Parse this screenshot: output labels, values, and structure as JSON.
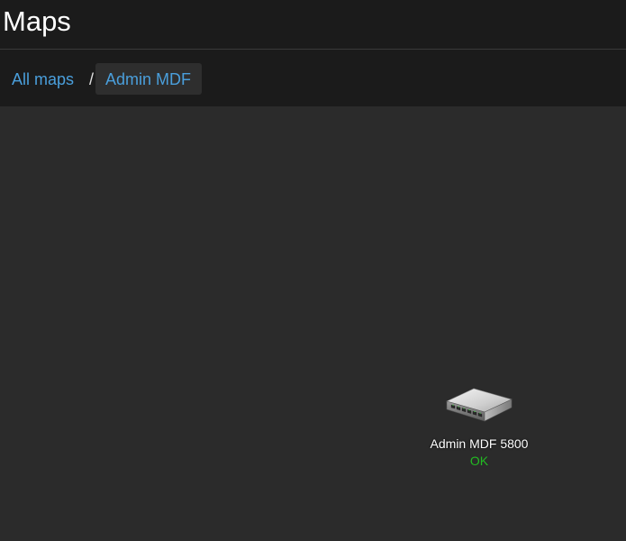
{
  "header": {
    "title": "Maps"
  },
  "breadcrumb": {
    "items": [
      {
        "label": "All maps"
      },
      {
        "label": "Admin MDF"
      }
    ],
    "separator": "/"
  },
  "map": {
    "nodes": [
      {
        "label": "Admin MDF 5800",
        "status": "OK",
        "status_color": "#22bb22",
        "icon": "network-switch-icon"
      }
    ]
  },
  "colors": {
    "link": "#4a9fdc",
    "background": "#1b1b1b",
    "canvas": "#2b2b2b"
  }
}
